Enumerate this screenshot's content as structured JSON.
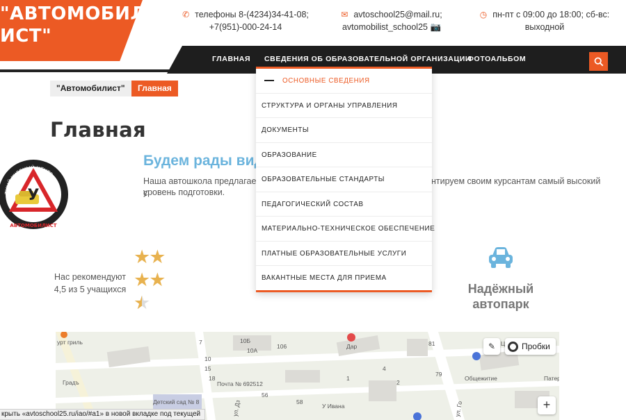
{
  "header": {
    "logo_line1": "\"АВТОМОБИЛ",
    "logo_line2": "ИСТ\"",
    "phone_line1": "телефоны 8-(4234)34-41-08;",
    "phone_line2": "+7(951)-000-24-14",
    "email_line1": "avtoschool25@mail.ru;",
    "email_line2": "avtomobilist_school25 📷",
    "hours_line1": "пн-пт с 09:00 до 18:00; сб-вс:",
    "hours_line2": "выходной"
  },
  "nav": {
    "items": [
      "ГЛАВНАЯ",
      "СВЕДЕНИЯ ОБ ОБРАЗОВАТЕЛЬНОЙ ОРГАНИЗАЦИИ",
      "ФОТОАЛЬБОМ"
    ]
  },
  "dropdown": {
    "items": [
      "ОСНОВНЫЕ СВЕДЕНИЯ",
      "СТРУКТУРА И ОРГАНЫ УПРАВЛЕНИЯ",
      "ДОКУМЕНТЫ",
      "ОБРАЗОВАНИЕ",
      "ОБРАЗОВАТЕЛЬНЫЕ СТАНДАРТЫ",
      "ПЕДАГОГИЧЕСКИЙ СОСТАВ",
      "МАТЕРИАЛЬНО-ТЕХНИЧЕСКОЕ ОБЕСПЕЧЕНИЕ",
      "ПЛАТНЫЕ ОБРАЗОВАТЕЛЬНЫЕ УСЛУГИ",
      "ВАКАНТНЫЕ МЕСТА ДЛЯ ПРИЕМА"
    ]
  },
  "breadcrumb": [
    "\"Автомобилист\"",
    "Главная"
  ],
  "page_title": "Главная",
  "emblem": {
    "ring_text": "ТНЫЙ УЧЕБНЫЙ ЦЕНТР",
    "bottom_text": "АВТОМОБИЛИСТ",
    "letter": "У"
  },
  "welcome": {
    "heading": "Будем рады вид",
    "text_a": "Наша автошкола предлагает с",
    "text_b": "нтируем своим курсантам самый высокий",
    "text_c": "уровень подготовки."
  },
  "rating": {
    "line1": "Нас рекомендуют",
    "line2": "4,5 из 5 учащихся",
    "value": 4.5,
    "max": 5
  },
  "feature": {
    "icon": "car-icon",
    "title_line1": "Надёжный",
    "title_line2": "автопарк"
  },
  "map": {
    "traffic_label": "Пробки",
    "labels": [
      "урт гриль",
      "Градъ",
      "Почта № 692512",
      "Детский сад № 8",
      "Дар",
      "У Ивана",
      "Общежитие",
      "Патер",
      "ул. Дз",
      "ул. Го",
      "10А",
      "10Б",
      "106",
      "81",
      "79",
      "56",
      "58",
      "7",
      "10",
      "15",
      "18",
      "1",
      "2",
      "4",
      "Ц"
    ]
  },
  "statusbar": "крыть «avtoschool25.ru/iao/#a1» в новой вкладке под текущей",
  "colors": {
    "accent": "#ec5a24",
    "nav_bg": "#1e1e1e",
    "welcome": "#6bb4dd",
    "star": "#e8b24f",
    "car": "#6bb4dd"
  }
}
